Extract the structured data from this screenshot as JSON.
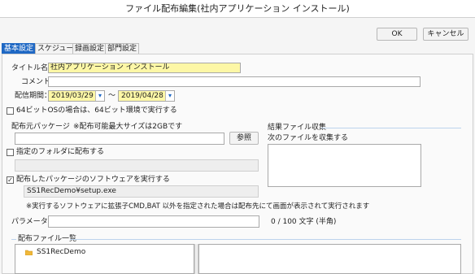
{
  "window": {
    "title": "ファイル配布編集(社内アプリケーション インストール)"
  },
  "buttons": {
    "ok": "OK",
    "cancel": "キャンセル",
    "browse": "参照"
  },
  "tabs": [
    {
      "label": "基本設定",
      "active": true
    },
    {
      "label": "スケジュール",
      "active": false
    },
    {
      "label": "録画設定",
      "active": false
    },
    {
      "label": "部門設定",
      "active": false
    }
  ],
  "form": {
    "title_label": "タイトル名：",
    "title_value": "社内アプリケーション インストール",
    "comment_label": "コメント：",
    "comment_value": "",
    "period_label": "配信期間：",
    "period_start": "2019/03/29",
    "period_tilde": "～",
    "period_end": "2019/04/28",
    "x64_label": "64ビットOSの場合は、64ビット環境で実行する",
    "source_label": "配布元パッケージ",
    "source_note": "※配布可能最大サイズは2GBです",
    "source_value": "",
    "folder_label": "指定のフォルダに配布する",
    "folder_value": "",
    "run_label": "配布したパッケージのソフトウェアを実行する",
    "run_value": "SS1RecDemo¥setup.exe",
    "run_note": "※実行するソフトウェアに拡張子CMD,BAT 以外を指定された場合は配布先にて画面が表示されて実行されます",
    "param_label": "パラメータ：",
    "param_value": "",
    "param_counter": "0 / 100 文字 (半角)"
  },
  "result_group": {
    "title": "結果ファイル収集",
    "sub_label": "次のファイルを収集する"
  },
  "file_list": {
    "title": "配布ファイル一覧",
    "items": [
      "SS1RecDemo"
    ]
  },
  "checks": {
    "x64": false,
    "folder": false,
    "run": true
  },
  "colors": {
    "accent": "#1f68c4",
    "highlight": "#fdf7a6"
  },
  "icons": {
    "dropdown": "▾",
    "folder": "folder-icon",
    "check": "✓"
  }
}
